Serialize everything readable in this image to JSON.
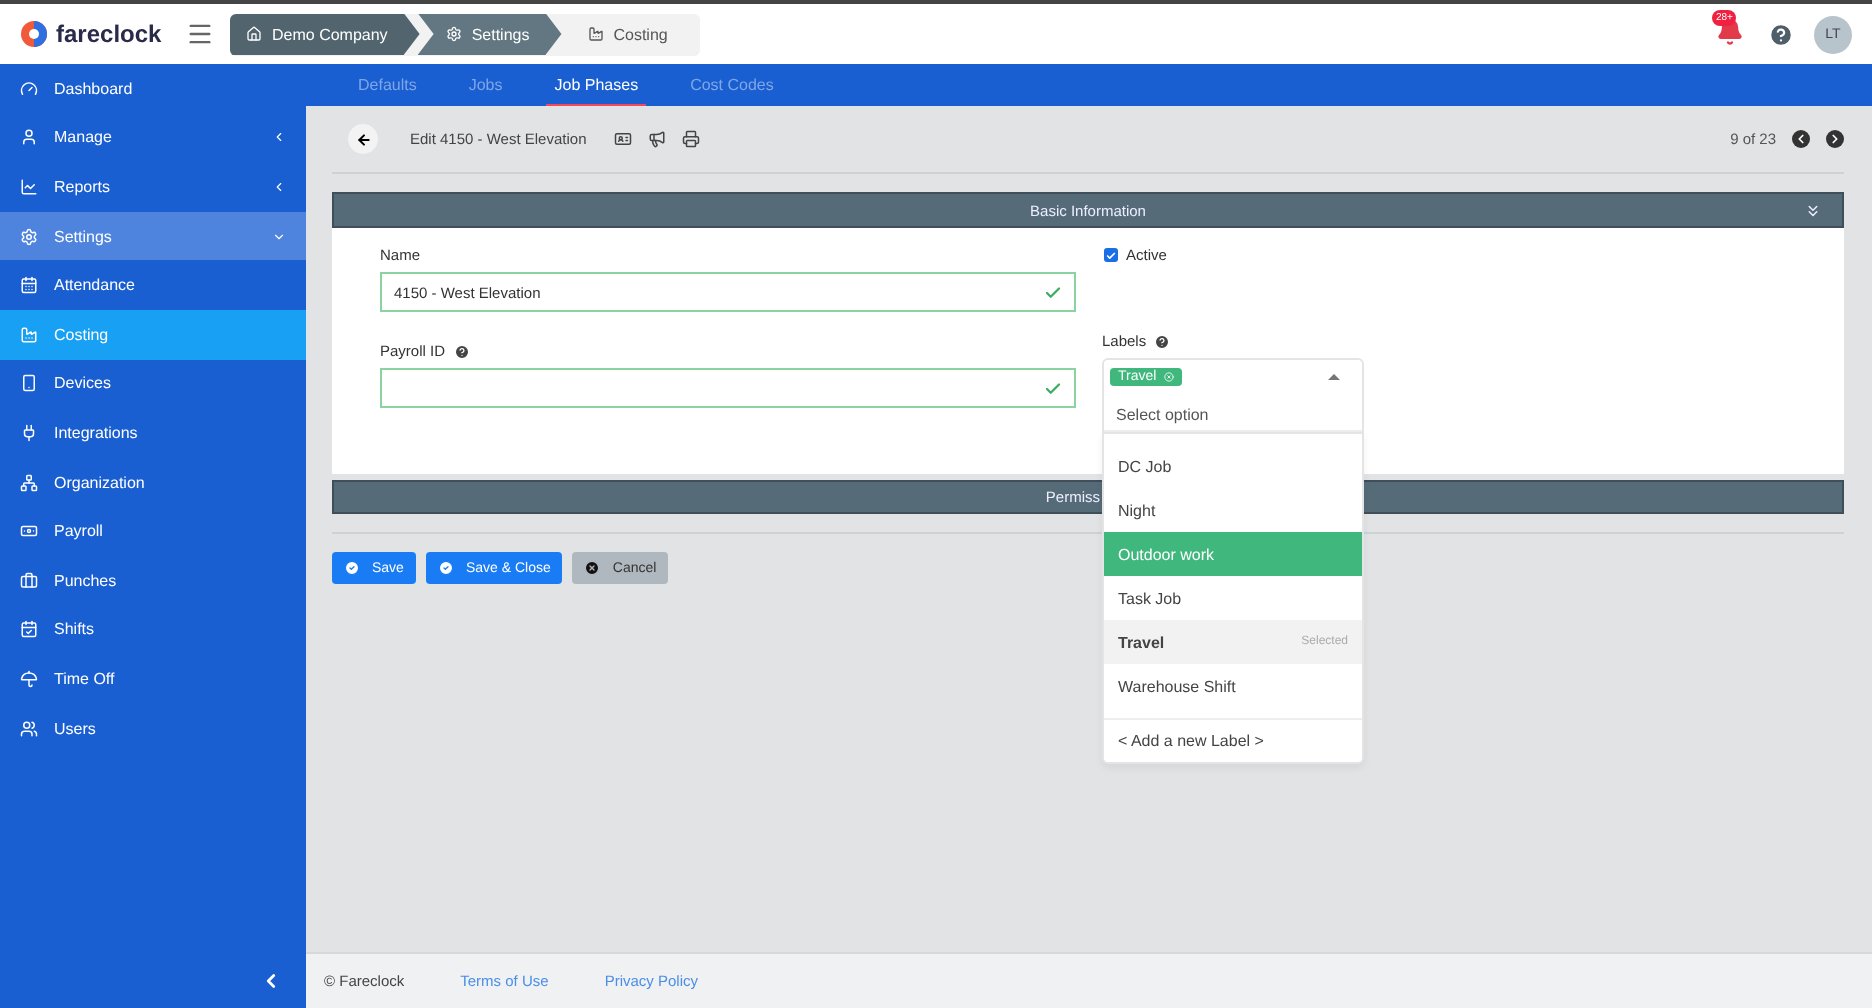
{
  "app": {
    "logo": "fareclock"
  },
  "breadcrumbs": [
    {
      "label": "Demo Company",
      "selected": false
    },
    {
      "label": "Settings",
      "selected": false
    },
    {
      "label": "Costing",
      "selected": true
    }
  ],
  "notifications": {
    "badge": "28+"
  },
  "user": {
    "initials": "LT"
  },
  "sidebar": {
    "items": [
      {
        "label": "Dashboard",
        "selected": false
      },
      {
        "label": "Manage",
        "selected": false,
        "expanded": false
      },
      {
        "label": "Reports",
        "selected": false,
        "expanded": false
      },
      {
        "label": "Settings",
        "selected": false,
        "expanded": true
      },
      {
        "label": "Attendance",
        "selected": false
      },
      {
        "label": "Costing",
        "selected": true
      },
      {
        "label": "Devices",
        "selected": false
      },
      {
        "label": "Integrations",
        "selected": false
      },
      {
        "label": "Organization",
        "selected": false
      },
      {
        "label": "Payroll",
        "selected": false
      },
      {
        "label": "Punches",
        "selected": false
      },
      {
        "label": "Shifts",
        "selected": false
      },
      {
        "label": "Time Off",
        "selected": false
      },
      {
        "label": "Users",
        "selected": false
      }
    ]
  },
  "tabs": [
    {
      "label": "Defaults",
      "selected": false
    },
    {
      "label": "Jobs",
      "selected": false
    },
    {
      "label": "Job Phases",
      "selected": true
    },
    {
      "label": "Cost Codes",
      "selected": false
    }
  ],
  "toolbar": {
    "title": "Edit 4150 - West Elevation",
    "position": "9 of 23"
  },
  "basic_information": {
    "title": "Basic Information",
    "expanded": true
  },
  "form": {
    "name": {
      "label": "Name",
      "value": "4150 - West Elevation",
      "valid": true
    },
    "payroll_id": {
      "label": "Payroll ID",
      "valid": true
    },
    "active": {
      "label": "Active",
      "checked": true
    },
    "labels": {
      "label": "Labels",
      "open": true,
      "tags": [
        {
          "label": "Travel"
        }
      ],
      "placeholder": "Select option",
      "options": [
        {
          "label": "DC Job",
          "selected": false,
          "highlighted": false
        },
        {
          "label": "Night",
          "selected": false,
          "highlighted": false
        },
        {
          "label": "Outdoor work",
          "selected": false,
          "highlighted": true
        },
        {
          "label": "Task Job",
          "selected": false,
          "highlighted": false
        },
        {
          "label": "Travel",
          "selected": true,
          "highlighted": false,
          "note": "Selected"
        },
        {
          "label": "Warehouse Shift",
          "selected": false,
          "highlighted": false
        }
      ],
      "add_option": "< Add a new Label >"
    }
  },
  "permissions": {
    "title": "Permiss"
  },
  "actions": [
    {
      "label": "Save",
      "kind": "primary"
    },
    {
      "label": "Save & Close",
      "kind": "primary"
    },
    {
      "label": "Cancel",
      "kind": "secondary"
    }
  ],
  "footer": {
    "copyright": "© Fareclock",
    "links": [
      "Terms of Use",
      "Privacy Policy"
    ]
  }
}
